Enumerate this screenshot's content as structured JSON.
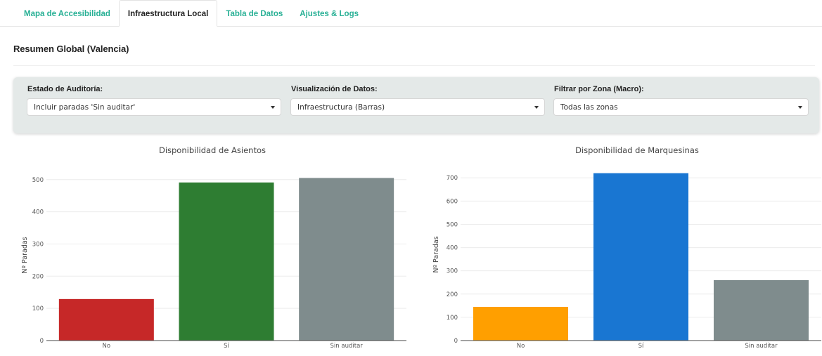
{
  "tabs": [
    {
      "label": "Mapa de Accesibilidad",
      "active": false
    },
    {
      "label": "Infraestructura Local",
      "active": true
    },
    {
      "label": "Tabla de Datos",
      "active": false
    },
    {
      "label": "Ajustes & Logs",
      "active": false
    }
  ],
  "summary_title": "Resumen Global (Valencia)",
  "filters": [
    {
      "label": "Estado de Auditoría:",
      "value": "Incluir paradas 'Sin auditar'",
      "icon": "chevron-down-icon"
    },
    {
      "label": "Visualización de Datos:",
      "value": "Infraestructura (Barras)",
      "icon": "chevron-down-icon"
    },
    {
      "label": "Filtrar por Zona (Macro):",
      "value": "Todas las zonas",
      "icon": "chevron-down-icon"
    }
  ],
  "colors": {
    "accent": "#28b095",
    "panel": "#e4e9e8"
  },
  "chart_data": [
    {
      "type": "bar",
      "title": "Disponibilidad de Asientos",
      "xlabel": "",
      "ylabel": "Nº Paradas",
      "categories": [
        "No",
        "Sí",
        "Sin auditar"
      ],
      "values": [
        129,
        491,
        505
      ],
      "colors": [
        "#c62828",
        "#2e7d32",
        "#7f8c8d"
      ],
      "ylim": [
        0,
        530
      ],
      "yticks": [
        0,
        100,
        200,
        300,
        400,
        500
      ],
      "grid": true
    },
    {
      "type": "bar",
      "title": "Disponibilidad de Marquesinas",
      "xlabel": "",
      "ylabel": "Nº Paradas",
      "categories": [
        "No",
        "Sí",
        "Sin auditar"
      ],
      "values": [
        145,
        720,
        260
      ],
      "colors": [
        "#ff9f00",
        "#1976d2",
        "#7f8c8d"
      ],
      "ylim": [
        0,
        740
      ],
      "yticks": [
        0,
        100,
        200,
        300,
        400,
        500,
        600,
        700
      ],
      "grid": true
    }
  ]
}
